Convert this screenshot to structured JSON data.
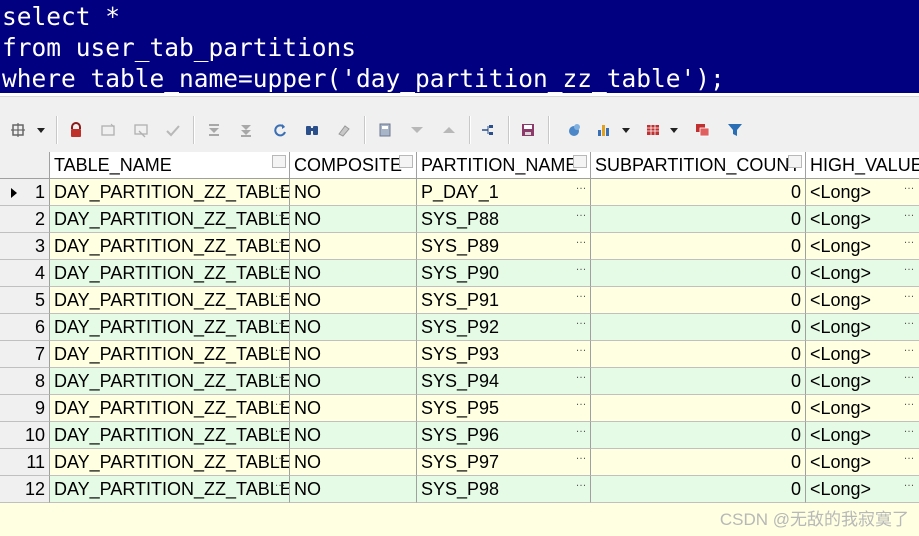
{
  "sql": {
    "lines": [
      "select *",
      "from user_tab_partitions",
      "where table_name=upper('day_partition_zz_table');"
    ]
  },
  "toolbar": {
    "icons": [
      "grid-options-icon",
      "lock-icon",
      "insert-record-icon",
      "delete-record-icon",
      "post-changes-icon",
      "first-record-icon",
      "last-record-icon",
      "refresh-icon",
      "find-icon",
      "clear-icon",
      "save-layout-icon",
      "sort-down-icon",
      "sort-up-icon",
      "link-icon",
      "save-icon",
      "query-builder-icon",
      "chart-icon",
      "export-table-icon",
      "copy-table-icon",
      "filter-icon"
    ]
  },
  "grid": {
    "columns": [
      "TABLE_NAME",
      "COMPOSITE",
      "PARTITION_NAME",
      "SUBPARTITION_COUNT",
      "HIGH_VALUE"
    ],
    "rows": [
      {
        "num": "1",
        "table_name": "DAY_PARTITION_ZZ_TABLE",
        "composite": "NO",
        "partition_name": "P_DAY_1",
        "subpartition_count": "0",
        "high_value": "<Long>"
      },
      {
        "num": "2",
        "table_name": "DAY_PARTITION_ZZ_TABLE",
        "composite": "NO",
        "partition_name": "SYS_P88",
        "subpartition_count": "0",
        "high_value": "<Long>"
      },
      {
        "num": "3",
        "table_name": "DAY_PARTITION_ZZ_TABLE",
        "composite": "NO",
        "partition_name": "SYS_P89",
        "subpartition_count": "0",
        "high_value": "<Long>"
      },
      {
        "num": "4",
        "table_name": "DAY_PARTITION_ZZ_TABLE",
        "composite": "NO",
        "partition_name": "SYS_P90",
        "subpartition_count": "0",
        "high_value": "<Long>"
      },
      {
        "num": "5",
        "table_name": "DAY_PARTITION_ZZ_TABLE",
        "composite": "NO",
        "partition_name": "SYS_P91",
        "subpartition_count": "0",
        "high_value": "<Long>"
      },
      {
        "num": "6",
        "table_name": "DAY_PARTITION_ZZ_TABLE",
        "composite": "NO",
        "partition_name": "SYS_P92",
        "subpartition_count": "0",
        "high_value": "<Long>"
      },
      {
        "num": "7",
        "table_name": "DAY_PARTITION_ZZ_TABLE",
        "composite": "NO",
        "partition_name": "SYS_P93",
        "subpartition_count": "0",
        "high_value": "<Long>"
      },
      {
        "num": "8",
        "table_name": "DAY_PARTITION_ZZ_TABLE",
        "composite": "NO",
        "partition_name": "SYS_P94",
        "subpartition_count": "0",
        "high_value": "<Long>"
      },
      {
        "num": "9",
        "table_name": "DAY_PARTITION_ZZ_TABLE",
        "composite": "NO",
        "partition_name": "SYS_P95",
        "subpartition_count": "0",
        "high_value": "<Long>"
      },
      {
        "num": "10",
        "table_name": "DAY_PARTITION_ZZ_TABLE",
        "composite": "NO",
        "partition_name": "SYS_P96",
        "subpartition_count": "0",
        "high_value": "<Long>"
      },
      {
        "num": "11",
        "table_name": "DAY_PARTITION_ZZ_TABLE",
        "composite": "NO",
        "partition_name": "SYS_P97",
        "subpartition_count": "0",
        "high_value": "<Long>"
      },
      {
        "num": "12",
        "table_name": "DAY_PARTITION_ZZ_TABLE",
        "composite": "NO",
        "partition_name": "SYS_P98",
        "subpartition_count": "0",
        "high_value": "<Long>"
      }
    ]
  },
  "colors": {
    "selection": "#000080",
    "row_odd": "#ffffe1",
    "row_even": "#e6fbe6"
  },
  "watermark": "CSDN @无敌的我寂寞了"
}
